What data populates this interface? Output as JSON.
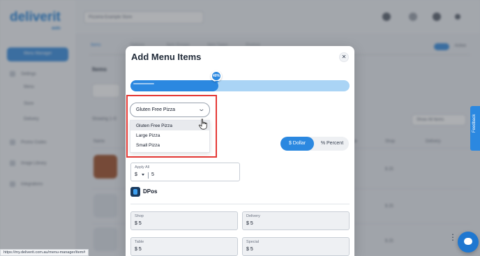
{
  "background": {
    "logo": "deliverit",
    "logo_sub": "auto",
    "nav_active": "Menu Manager",
    "nav_items": [
      "Settings",
      "Menu",
      "Store",
      "Delivery",
      "Promo Codes",
      "Image Library",
      "Integrations"
    ],
    "store_select": "Pizzeria Example Store",
    "tabs": [
      "Items",
      "Options",
      "Item Groups",
      "Item Types",
      "Promos"
    ],
    "toggle_label": "Active",
    "heading": "Items",
    "showing": "Showing 1–5",
    "filter": "Show All Items",
    "columns": [
      "Name",
      "Price",
      "Shop",
      "Delivery"
    ],
    "row_values": [
      "$ 25",
      "$ 25",
      "$ 25"
    ]
  },
  "modal": {
    "title": "Add Menu Items",
    "close_symbol": "✕",
    "progress": {
      "percent": 40,
      "label": "40%"
    },
    "size_select": {
      "value": "Gluten Free Pizza",
      "options": [
        "Gluten Free Pizza",
        "Large Pizza",
        "Small Pizza"
      ],
      "hovered_index": 0
    },
    "price_mode": {
      "dollar_label": "$ Dollar",
      "percent_label": "% Percent",
      "selected": "dollar"
    },
    "apply_all": {
      "label": "Apply All",
      "currency": "$",
      "value": "5"
    },
    "pos": {
      "name": "DPos"
    },
    "prices": [
      {
        "label": "Shop",
        "value": "$ 5"
      },
      {
        "label": "Delivery",
        "value": "$ 5"
      },
      {
        "label": "Table",
        "value": "$ 5"
      },
      {
        "label": "Special",
        "value": "$ 5"
      }
    ]
  },
  "feedback_label": "Feedback",
  "status_url": "https://my.deliverit.com.au/menu-manager/item#",
  "colors": {
    "accent": "#2b88e0",
    "highlight": "#e53935"
  }
}
